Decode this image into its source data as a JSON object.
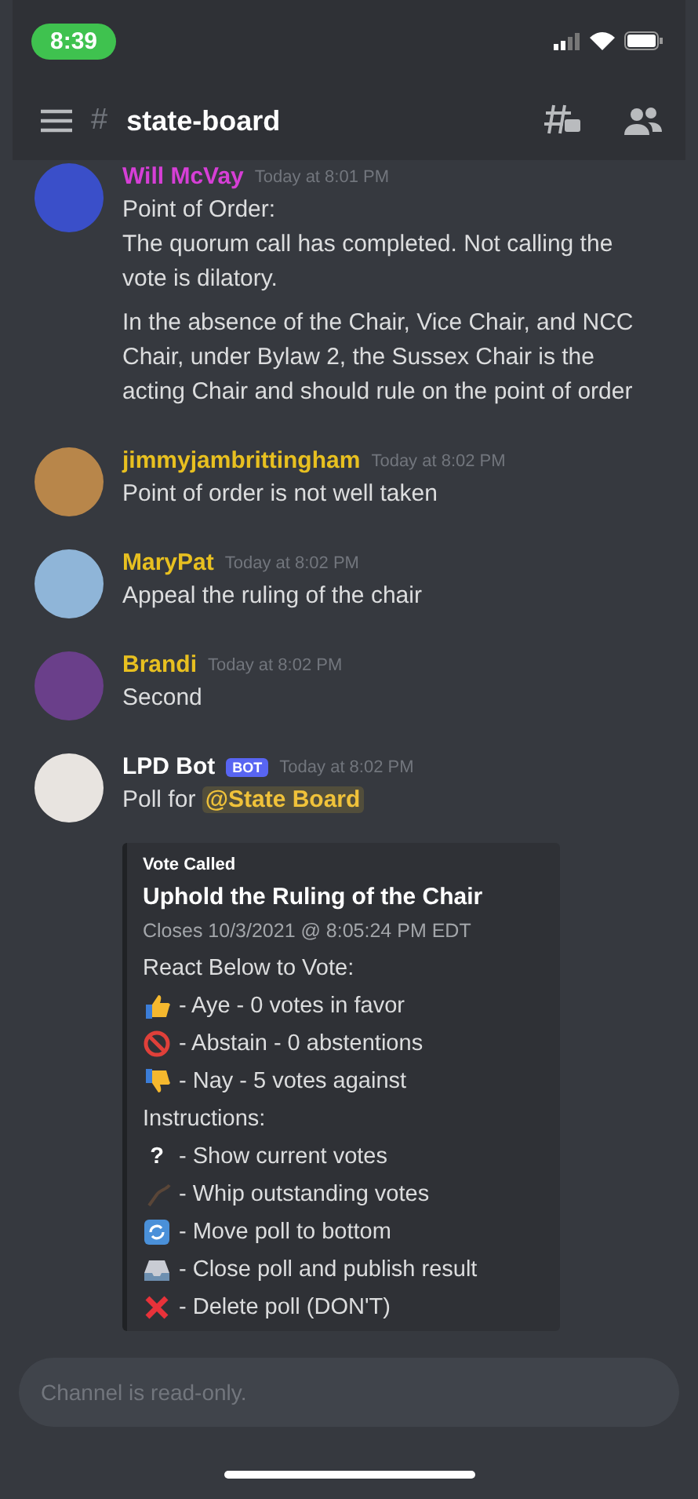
{
  "status_bar": {
    "time": "8:39"
  },
  "header": {
    "channel_prefix": "#",
    "channel": "state-board"
  },
  "messages": [
    {
      "author": "Will McVay",
      "color": "#d63fd6",
      "time": "Today at 8:01 PM",
      "paragraphs": [
        "Point of Order:\nThe quorum call has completed.  Not calling the vote is dilatory.",
        "In the absence of the Chair, Vice Chair, and NCC Chair, under Bylaw 2, the Sussex Chair is the acting Chair and should rule on the point of order"
      ]
    },
    {
      "author": "jimmyjambrittingham",
      "color": "#e8c020",
      "time": "Today at 8:02 PM",
      "paragraphs": [
        "Point of order is not well taken"
      ]
    },
    {
      "author": "MaryPat",
      "color": "#e8c020",
      "time": "Today at 8:02 PM",
      "paragraphs": [
        "Appeal the ruling of the chair"
      ]
    },
    {
      "author": "Brandi",
      "color": "#e8c020",
      "time": "Today at 8:02 PM",
      "paragraphs": [
        "Second"
      ]
    },
    {
      "author": "LPD Bot",
      "color": "#ffffff",
      "bot_tag": "BOT",
      "time": "Today at 8:02 PM",
      "text": "Poll for",
      "mention": "@State Board",
      "embed": {
        "author": "Vote Called",
        "title": "Uphold the Ruling of the Chair",
        "subtitle": "Closes 10/3/2021 @ 8:05:24 PM EDT",
        "lines": [
          {
            "kind": "text",
            "text": "React Below to Vote:"
          },
          {
            "kind": "icon",
            "text": "- Aye - 0 votes in favor"
          },
          {
            "kind": "icon",
            "text": "- Abstain - 0 abstentions"
          },
          {
            "kind": "icon",
            "text": "- Nay - 5 votes against"
          },
          {
            "kind": "text",
            "text": "Instructions:"
          },
          {
            "kind": "glyph",
            "glyph": "?",
            "text": "- Show current votes"
          },
          {
            "kind": "icon",
            "text": "- Whip outstanding votes"
          },
          {
            "kind": "icon",
            "text": "- Move poll to bottom"
          },
          {
            "kind": "icon",
            "text": "- Close poll and publish result"
          },
          {
            "kind": "icon",
            "text": "- Delete poll (DON'T)"
          }
        ]
      }
    }
  ],
  "composer": {
    "placeholder": "Channel is read-only."
  }
}
